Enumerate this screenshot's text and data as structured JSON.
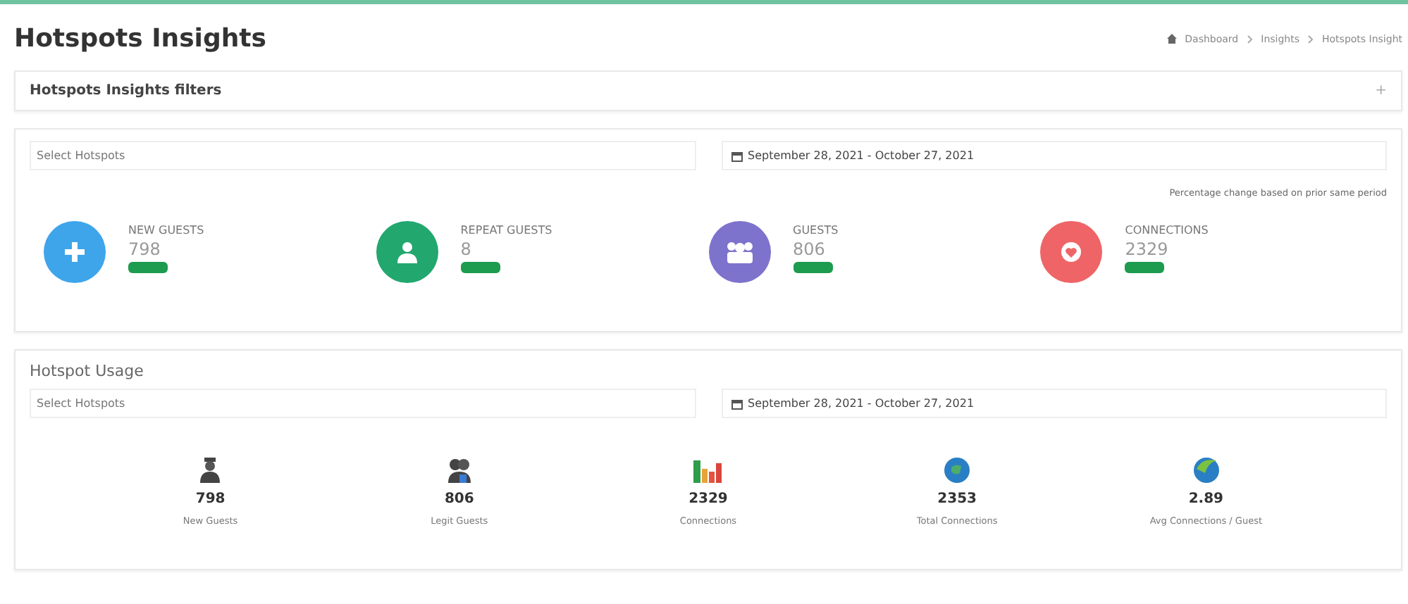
{
  "page": {
    "title": "Hotspots Insights",
    "breadcrumb": [
      "Dashboard",
      "Insights",
      "Hotspots Insight"
    ]
  },
  "filters_bar": {
    "title": "Hotspots Insights filters",
    "toggle": "+"
  },
  "insights": {
    "select": {
      "placeholder": "Select Hotspots"
    },
    "date_range": "September 28, 2021 - October 27, 2021",
    "note": "Percentage change based on prior same period",
    "stats": [
      {
        "kind": "plus",
        "label": "NEW GUESTS",
        "value": "798",
        "color": "#3ea5ea"
      },
      {
        "kind": "user",
        "label": "REPEAT GUESTS",
        "value": "8",
        "color": "#22a76f"
      },
      {
        "kind": "group",
        "label": "GUESTS",
        "value": "806",
        "color": "#7d72cc"
      },
      {
        "kind": "heart",
        "label": "CONNECTIONS",
        "value": "2329",
        "color": "#ef6466"
      }
    ]
  },
  "usage": {
    "title": "Hotspot Usage",
    "select": {
      "placeholder": "Select Hotspots"
    },
    "date_range": "September 28, 2021 - October 27, 2021",
    "metrics": [
      {
        "kind": "person",
        "value": "798",
        "label": "New Guests"
      },
      {
        "kind": "people",
        "value": "806",
        "label": "Legit Guests"
      },
      {
        "kind": "bars",
        "value": "2329",
        "label": "Connections"
      },
      {
        "kind": "globe",
        "value": "2353",
        "label": "Total Connections"
      },
      {
        "kind": "globe2",
        "value": "2.89",
        "label": "Avg Connections / Guest"
      }
    ]
  }
}
